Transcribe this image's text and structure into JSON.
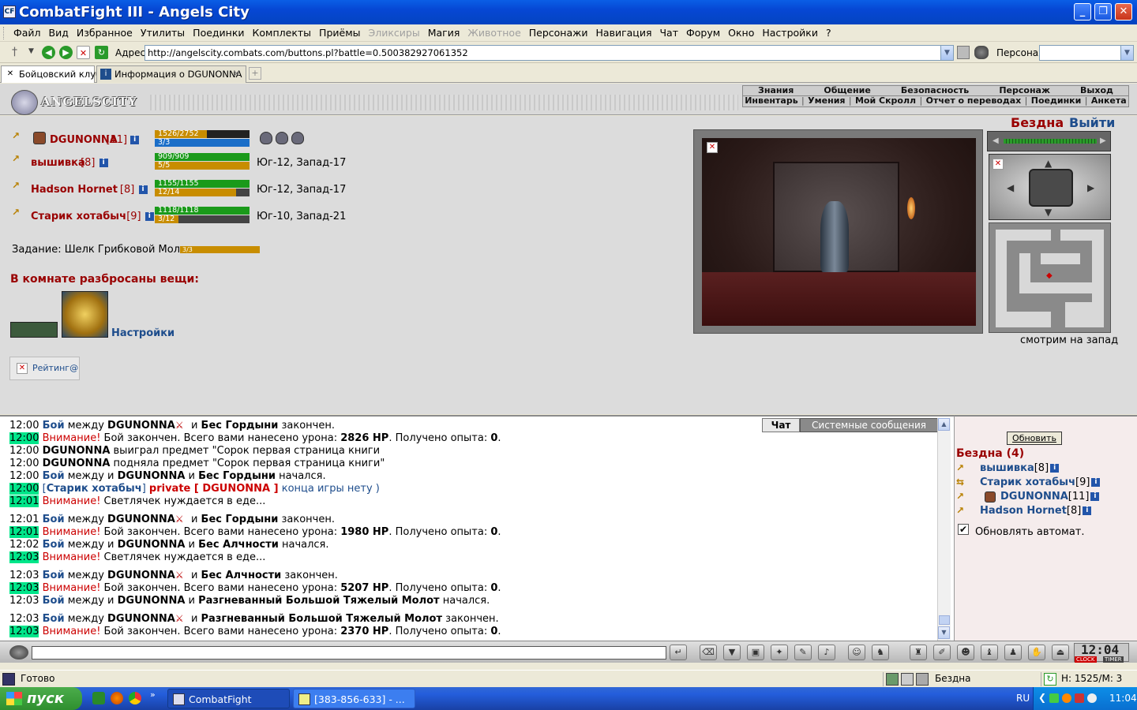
{
  "window": {
    "title": "CombatFight III - Angels City"
  },
  "menu": [
    "Файл",
    "Вид",
    "Избранное",
    "Утилиты",
    "Поединки",
    "Комплекты",
    "Приёмы",
    "Эликсиры",
    "Магия",
    "Животное",
    "Персонажи",
    "Навигация",
    "Чат",
    "Форум",
    "Окно",
    "Настройки",
    "?"
  ],
  "menu_disabled": [
    "Эликсиры",
    "Животное"
  ],
  "address": {
    "label": "Адрес:",
    "url": "http://angelscity.combats.com/buttons.pl?battle=0.500382927061352",
    "persona_label": "Персонаж:"
  },
  "tabs": [
    {
      "label": "Бойцовский клуб",
      "active": true
    },
    {
      "label": "Информация о DGUNONNA",
      "active": false
    }
  ],
  "game_header": {
    "logo": "ANGELSCITY",
    "nav_top": [
      "Знания",
      "Общение",
      "Безопасность",
      "Персонаж",
      "Выход"
    ],
    "nav_bottom": [
      "Инвентарь",
      "Умения",
      "Мой Скролл",
      "Отчет о переводах",
      "Поединки",
      "Анкета"
    ]
  },
  "players": [
    {
      "name": "DGUNONNA",
      "level": "[11]",
      "hp_text": "1526/2752",
      "hp": 0.55,
      "mana_text": "3/3",
      "mana": 1.0,
      "mana_color": "#1a6ec8",
      "location": ""
    },
    {
      "name": "вышивка",
      "level": "[8]",
      "hp_text": "909/909",
      "hp": 1.0,
      "mana_text": "5/5",
      "mana": 1.0,
      "mana_color": "#c88d00",
      "location": "Юг-12, Запад-17"
    },
    {
      "name": "Hadson Hornet",
      "level": "[8]",
      "hp_text": "1155/1155",
      "hp": 1.0,
      "mana_text": "12/14",
      "mana": 0.857,
      "mana_color": "#c88d00",
      "location": "Юг-12, Запад-17"
    },
    {
      "name": "Старик хотабыч",
      "level": "[9]",
      "hp_text": "1118/1118",
      "hp": 1.0,
      "mana_text": "3/12",
      "mana": 0.25,
      "mana_color": "#c88d00",
      "location": "Юг-10, Запад-21"
    }
  ],
  "task": {
    "label": "Задание: Шелк Грибковой Моли",
    "progress": "3/3"
  },
  "room_items": {
    "title": "В комнате разбросаны вещи:",
    "link": "Настройки"
  },
  "rating": "Рейтинг@",
  "zone": {
    "name": "Бездна",
    "exit": "Выйти",
    "looking": "смотрим на запад"
  },
  "chat_tabs": [
    "Чат",
    "Системные сообщения"
  ],
  "chat": [
    {
      "time": "12:00",
      "hl": false,
      "parts": [
        [
          "bn",
          "Бой"
        ],
        [
          "t",
          " между "
        ],
        [
          "b",
          "DGUNONNA"
        ],
        [
          "sw",
          ""
        ],
        [
          "t",
          " и "
        ],
        [
          "b",
          "Бес Гордыни"
        ],
        [
          "t",
          " закончен."
        ]
      ]
    },
    {
      "time": "12:00",
      "hl": true,
      "parts": [
        [
          "w",
          "Внимание!"
        ],
        [
          "t",
          " Бой закончен. Всего вами нанесено урона: "
        ],
        [
          "b",
          "2826 HP"
        ],
        [
          "t",
          ". Получено опыта: "
        ],
        [
          "b",
          "0"
        ],
        [
          "t",
          "."
        ]
      ]
    },
    {
      "time": "12:00",
      "hl": false,
      "parts": [
        [
          "b",
          "DGUNONNA"
        ],
        [
          "t",
          " выиграл предмет \"Сорок первая страница книги"
        ]
      ]
    },
    {
      "time": "12:00",
      "hl": false,
      "parts": [
        [
          "b",
          "DGUNONNA"
        ],
        [
          "t",
          " подняла предмет \"Сорок первая страница книги\""
        ]
      ]
    },
    {
      "time": "12:00",
      "hl": false,
      "parts": [
        [
          "bn",
          "Бой"
        ],
        [
          "t",
          " между  и "
        ],
        [
          "b",
          "DGUNONNA"
        ],
        [
          "t",
          " и "
        ],
        [
          "b",
          "Бес Гордыни"
        ],
        [
          "t",
          " начался."
        ]
      ]
    },
    {
      "time": "12:00",
      "hl": true,
      "parts": [
        [
          "s",
          "["
        ],
        [
          "bn",
          "Старик хотабыч"
        ],
        [
          "s",
          "]"
        ],
        [
          "t",
          " "
        ],
        [
          "p",
          "private [ DGUNONNA ]"
        ],
        [
          "s",
          " конца игры нету )"
        ]
      ]
    },
    {
      "time": "12:01",
      "hl": true,
      "parts": [
        [
          "w",
          "Внимание!"
        ],
        [
          "t",
          " Светлячек нуждается в еде..."
        ]
      ]
    },
    {
      "time": "12:01",
      "hl": false,
      "parts": [
        [
          "bn",
          "Бой"
        ],
        [
          "t",
          " между "
        ],
        [
          "b",
          "DGUNONNA"
        ],
        [
          "sw",
          ""
        ],
        [
          "t",
          " и "
        ],
        [
          "b",
          "Бес Гордыни"
        ],
        [
          "t",
          " закончен."
        ]
      ]
    },
    {
      "time": "12:01",
      "hl": true,
      "parts": [
        [
          "w",
          "Внимание!"
        ],
        [
          "t",
          " Бой закончен. Всего вами нанесено урона: "
        ],
        [
          "b",
          "1980 HP"
        ],
        [
          "t",
          ". Получено опыта: "
        ],
        [
          "b",
          "0"
        ],
        [
          "t",
          "."
        ]
      ]
    },
    {
      "time": "12:02",
      "hl": false,
      "parts": [
        [
          "bn",
          "Бой"
        ],
        [
          "t",
          " между  и "
        ],
        [
          "b",
          "DGUNONNA"
        ],
        [
          "t",
          " и "
        ],
        [
          "b",
          "Бес Алчности"
        ],
        [
          "t",
          " начался."
        ]
      ]
    },
    {
      "time": "12:03",
      "hl": true,
      "parts": [
        [
          "w",
          "Внимание!"
        ],
        [
          "t",
          " Светлячек нуждается в еде..."
        ]
      ]
    },
    {
      "time": "12:03",
      "hl": false,
      "parts": [
        [
          "bn",
          "Бой"
        ],
        [
          "t",
          " между "
        ],
        [
          "b",
          "DGUNONNA"
        ],
        [
          "sw",
          ""
        ],
        [
          "t",
          " и "
        ],
        [
          "b",
          "Бес Алчности"
        ],
        [
          "t",
          " закончен."
        ]
      ]
    },
    {
      "time": "12:03",
      "hl": true,
      "parts": [
        [
          "w",
          "Внимание!"
        ],
        [
          "t",
          " Бой закончен. Всего вами нанесено урона: "
        ],
        [
          "b",
          "5207 HP"
        ],
        [
          "t",
          ". Получено опыта: "
        ],
        [
          "b",
          "0"
        ],
        [
          "t",
          "."
        ]
      ]
    },
    {
      "time": "12:03",
      "hl": false,
      "parts": [
        [
          "bn",
          "Бой"
        ],
        [
          "t",
          " между  и "
        ],
        [
          "b",
          "DGUNONNA"
        ],
        [
          "t",
          " и "
        ],
        [
          "b",
          "Разгневанный Большой Тяжелый Молот"
        ],
        [
          "t",
          " начался."
        ]
      ]
    },
    {
      "time": "12:03",
      "hl": false,
      "parts": [
        [
          "bn",
          "Бой"
        ],
        [
          "t",
          " между "
        ],
        [
          "b",
          "DGUNONNA"
        ],
        [
          "sw",
          ""
        ],
        [
          "t",
          " и "
        ],
        [
          "b",
          "Разгневанный Большой Тяжелый Молот"
        ],
        [
          "t",
          " закончен."
        ]
      ]
    },
    {
      "time": "12:03",
      "hl": true,
      "parts": [
        [
          "w",
          "Внимание!"
        ],
        [
          "t",
          " Бой закончен. Всего вами нанесено урона: "
        ],
        [
          "b",
          "2370 HP"
        ],
        [
          "t",
          ". Получено опыта: "
        ],
        [
          "b",
          "0"
        ],
        [
          "t",
          "."
        ]
      ]
    }
  ],
  "room_panel": {
    "refresh": "Обновить",
    "title": "Бездна (4)",
    "users": [
      {
        "name": "вышивка",
        "level": "[8]"
      },
      {
        "name": "Старик хотабыч",
        "level": "[9]"
      },
      {
        "name": "DGUNONNA",
        "level": "[11]"
      },
      {
        "name": "Hadson Hornet",
        "level": "[8]"
      }
    ],
    "auto_refresh": "Обновлять автомат."
  },
  "clock": {
    "time": "12:04",
    "clock_label": "CLOCK",
    "timer_label": "TIMER"
  },
  "status": {
    "ready": "Готово",
    "zone": "Бездна",
    "hm": "Н: 1525/М: 3"
  },
  "taskbar": {
    "start": "пуск",
    "buttons": [
      "CombatFight",
      "[383-856-633] - ..."
    ],
    "lang": "RU",
    "time": "11:04"
  }
}
